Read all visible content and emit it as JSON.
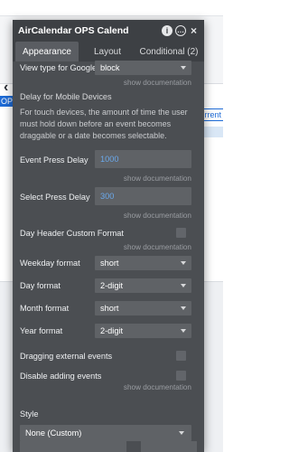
{
  "background": {
    "ops_label": "OPS",
    "current_label": "rrent",
    "nav_arrow": "‹"
  },
  "panel": {
    "title": "AirCalendar OPS Calend",
    "icons": [
      "info-icon",
      "comment-icon",
      "close-icon"
    ],
    "info_glyph": "i",
    "comment_glyph": "…",
    "close_glyph": "×",
    "tabs": [
      {
        "label": "Appearance",
        "active": true
      },
      {
        "label": "Layout",
        "active": false
      },
      {
        "label": "Conditional (2)",
        "active": false
      }
    ]
  },
  "fields": {
    "view_type_google": {
      "label": "View type for Google",
      "value": "block"
    },
    "show_doc": "show documentation",
    "delay_heading": "Delay for Mobile Devices",
    "delay_help": "For touch devices, the amount of time the user must hold down before an event becomes draggable or a date becomes selectable.",
    "event_press_delay": {
      "label": "Event Press Delay",
      "value": "1000"
    },
    "select_press_delay": {
      "label": "Select Press Delay",
      "value": "300"
    },
    "day_header_custom": {
      "label": "Day Header Custom Format"
    },
    "weekday_format": {
      "label": "Weekday format",
      "value": "short"
    },
    "day_format": {
      "label": "Day format",
      "value": "2-digit"
    },
    "month_format": {
      "label": "Month format",
      "value": "short"
    },
    "year_format": {
      "label": "Year format",
      "value": "2-digit"
    },
    "dragging_external": {
      "label": "Dragging external events"
    },
    "disable_adding": {
      "label": "Disable adding events"
    },
    "style": {
      "label": "Style",
      "value": "None (Custom)"
    }
  },
  "colors": {
    "panel_bg": "#4b4e52",
    "header_bg": "#3d4044",
    "field_bg": "#5f6266",
    "number_value": "#6aa8ea",
    "accent_blue": "#1e6bd6"
  }
}
